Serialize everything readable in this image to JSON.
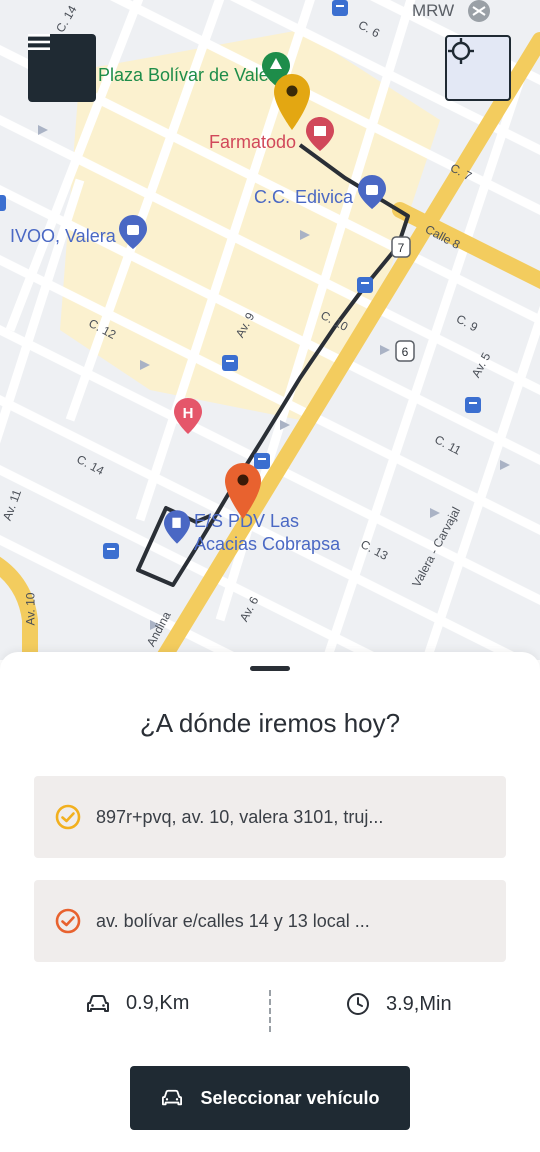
{
  "map": {
    "pois": {
      "plaza": "Plaza Bolívar de Valera",
      "farmatodo": "Farmatodo",
      "edivica": "C.C. Edivica",
      "ivoo": "IVOO, Valera",
      "gas_station_line1": "E/S PDV Las",
      "gas_station_line2": "Acacias Cobrapsa",
      "mrw": "MRW"
    },
    "streets": {
      "c14_top": "C. 14",
      "c6": "C. 6",
      "c7": "C. 7",
      "calle8": "Calle 8",
      "c9": "C. 9",
      "av5": "Av. 5",
      "c10": "C. 10",
      "av9": "Av. 9",
      "c12": "C. 12",
      "c11": "C. 11",
      "c14": "C. 14",
      "av11": "Av. 11",
      "c13": "C. 13",
      "valera_carvajal": "Valera - Carvajal",
      "av10": "Av. 10",
      "av6": "Av. 6",
      "andina": "Andina",
      "shield7": "7",
      "shield6": "6"
    },
    "colors": {
      "route": "#2a2f36",
      "origin_pin": "#e3a712",
      "destination_pin": "#e8622f",
      "poi_blue": "#4a68c4",
      "poi_red": "#d1485a",
      "poi_green": "#1e8d4a",
      "highway": "#f3cc5e",
      "block": "#fbf1cf"
    }
  },
  "header": {
    "menu_icon": "hamburger-menu-icon",
    "locate_icon": "crosshair-locate-icon"
  },
  "sheet": {
    "title": "¿A dónde iremos hoy?",
    "origin": {
      "text": "897r+pvq, av. 10, valera 3101, truj...",
      "icon": "check-circle-icon",
      "color": "#f2b01e"
    },
    "destination": {
      "text": "av. bolívar e/calles 14 y 13 local ...",
      "icon": "check-circle-icon",
      "color": "#e8622f"
    },
    "distance": "0.9,Km",
    "duration": "3.9,Min",
    "select_vehicle": "Seleccionar vehículo"
  }
}
